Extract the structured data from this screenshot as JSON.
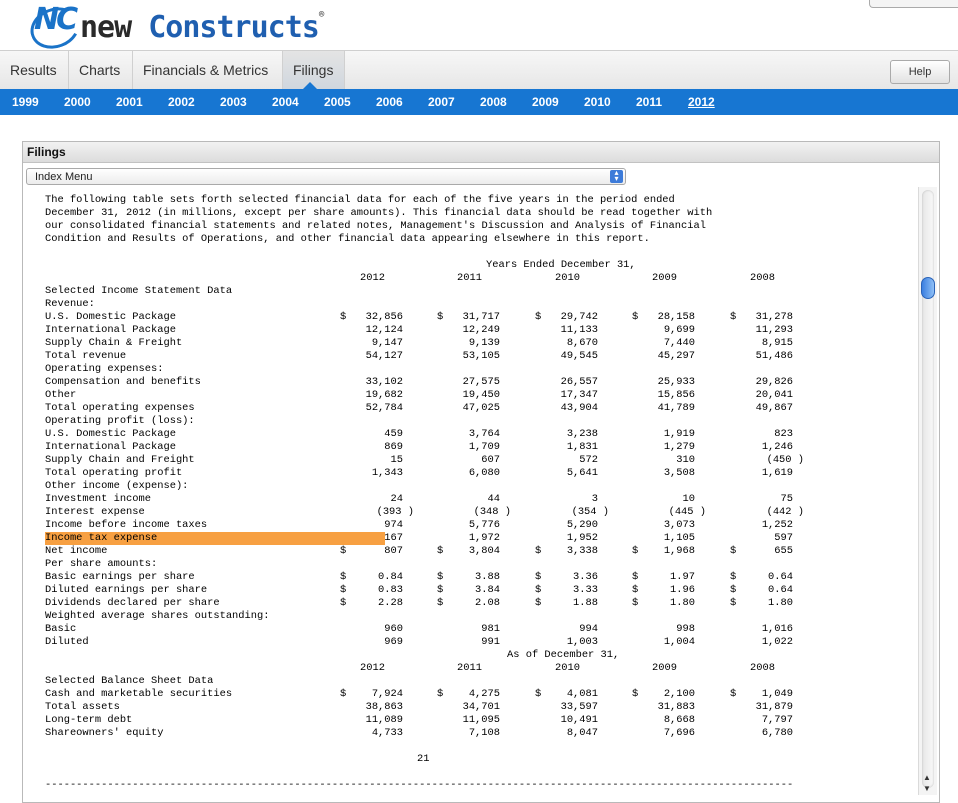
{
  "brand": {
    "logo_mark": "NC",
    "word1": "new",
    "word2": "Constructs",
    "reg": "®"
  },
  "tabs": [
    {
      "label": "Results"
    },
    {
      "label": "Charts"
    },
    {
      "label": "Financials & Metrics"
    },
    {
      "label": "Filings",
      "active": true
    }
  ],
  "help_label": "Help",
  "years": [
    "1999",
    "2000",
    "2001",
    "2002",
    "2003",
    "2004",
    "2005",
    "2006",
    "2007",
    "2008",
    "2009",
    "2010",
    "2011",
    "2012"
  ],
  "selected_year": "2012",
  "panel": {
    "title": "Filings",
    "select_value": "Index Menu"
  },
  "intro": [
    "The following table sets forth selected financial data for each of the five years in the period ended",
    "December 31, 2012 (in millions, except per share amounts). This financial data should be read together with",
    "our consolidated financial statements and related notes, Management's Discussion and Analysis of Financial",
    "Condition and Results of Operations, and other financial data appearing elsewhere in this report."
  ],
  "income_heading": "Years Ended December 31,",
  "balance_heading": "As of December 31,",
  "year_columns": [
    "2012",
    "2011",
    "2010",
    "2009",
    "2008"
  ],
  "income_rows": [
    {
      "label": "Selected Income Statement Data"
    },
    {
      "label": "Revenue:"
    },
    {
      "label": "U.S. Domestic Package",
      "dollar": true,
      "values": [
        "32,856",
        "31,717",
        "29,742",
        "28,158",
        "31,278"
      ]
    },
    {
      "label": "International Package",
      "values": [
        "12,124",
        "12,249",
        "11,133",
        "9,699",
        "11,293"
      ]
    },
    {
      "label": "Supply Chain & Freight",
      "values": [
        "9,147",
        "9,139",
        "8,670",
        "7,440",
        "8,915"
      ]
    },
    {
      "label": "Total revenue",
      "values": [
        "54,127",
        "53,105",
        "49,545",
        "45,297",
        "51,486"
      ]
    },
    {
      "label": "Operating expenses:"
    },
    {
      "label": "Compensation and benefits",
      "values": [
        "33,102",
        "27,575",
        "26,557",
        "25,933",
        "29,826"
      ]
    },
    {
      "label": "Other",
      "values": [
        "19,682",
        "19,450",
        "17,347",
        "15,856",
        "20,041"
      ]
    },
    {
      "label": "Total operating expenses",
      "values": [
        "52,784",
        "47,025",
        "43,904",
        "41,789",
        "49,867"
      ]
    },
    {
      "label": "Operating profit (loss):"
    },
    {
      "label": "U.S. Domestic Package",
      "values": [
        "459",
        "3,764",
        "3,238",
        "1,919",
        "823"
      ]
    },
    {
      "label": "International Package",
      "values": [
        "869",
        "1,709",
        "1,831",
        "1,279",
        "1,246"
      ]
    },
    {
      "label": "Supply Chain and Freight",
      "values": [
        "15",
        "607",
        "572",
        "310",
        "(450 )"
      ]
    },
    {
      "label": "Total operating profit",
      "values": [
        "1,343",
        "6,080",
        "5,641",
        "3,508",
        "1,619"
      ]
    },
    {
      "label": "Other income (expense):"
    },
    {
      "label": "Investment income",
      "values": [
        "24",
        "44",
        "3",
        "10",
        "75"
      ]
    },
    {
      "label": "Interest expense",
      "values": [
        "(393 )",
        "(348 )",
        "(354 )",
        "(445 )",
        "(442 )"
      ]
    },
    {
      "label": "Income before income taxes",
      "values": [
        "974",
        "5,776",
        "5,290",
        "3,073",
        "1,252"
      ]
    },
    {
      "label": "Income tax expense",
      "highlight": true,
      "values": [
        "167",
        "1,972",
        "1,952",
        "1,105",
        "597"
      ]
    },
    {
      "label": "Net income",
      "dollar": true,
      "values": [
        "807",
        "3,804",
        "3,338",
        "1,968",
        "655"
      ]
    },
    {
      "label": "Per share amounts:"
    },
    {
      "label": "Basic earnings per share",
      "dollar": true,
      "values": [
        "0.84",
        "3.88",
        "3.36",
        "1.97",
        "0.64"
      ]
    },
    {
      "label": "Diluted earnings per share",
      "dollar": true,
      "values": [
        "0.83",
        "3.84",
        "3.33",
        "1.96",
        "0.64"
      ]
    },
    {
      "label": "Dividends declared per share",
      "dollar": true,
      "values": [
        "2.28",
        "2.08",
        "1.88",
        "1.80",
        "1.80"
      ]
    },
    {
      "label": "Weighted average shares outstanding:"
    },
    {
      "label": "Basic",
      "values": [
        "960",
        "981",
        "994",
        "998",
        "1,016"
      ]
    },
    {
      "label": "Diluted",
      "values": [
        "969",
        "991",
        "1,003",
        "1,004",
        "1,022"
      ]
    }
  ],
  "balance_rows": [
    {
      "label": "Selected Balance Sheet Data"
    },
    {
      "label": "Cash and marketable securities",
      "dollar": true,
      "values": [
        "7,924",
        "4,275",
        "4,081",
        "2,100",
        "1,049"
      ]
    },
    {
      "label": "Total assets",
      "values": [
        "38,863",
        "34,701",
        "33,597",
        "31,883",
        "31,879"
      ]
    },
    {
      "label": "Long-term debt",
      "values": [
        "11,089",
        "11,095",
        "10,491",
        "8,668",
        "7,797"
      ]
    },
    {
      "label": "Shareowners' equity",
      "values": [
        "4,733",
        "7,108",
        "8,047",
        "7,696",
        "6,780"
      ]
    }
  ],
  "page_number": "21",
  "rule": "------------------------------------------------------------------------------------------------------------------------"
}
